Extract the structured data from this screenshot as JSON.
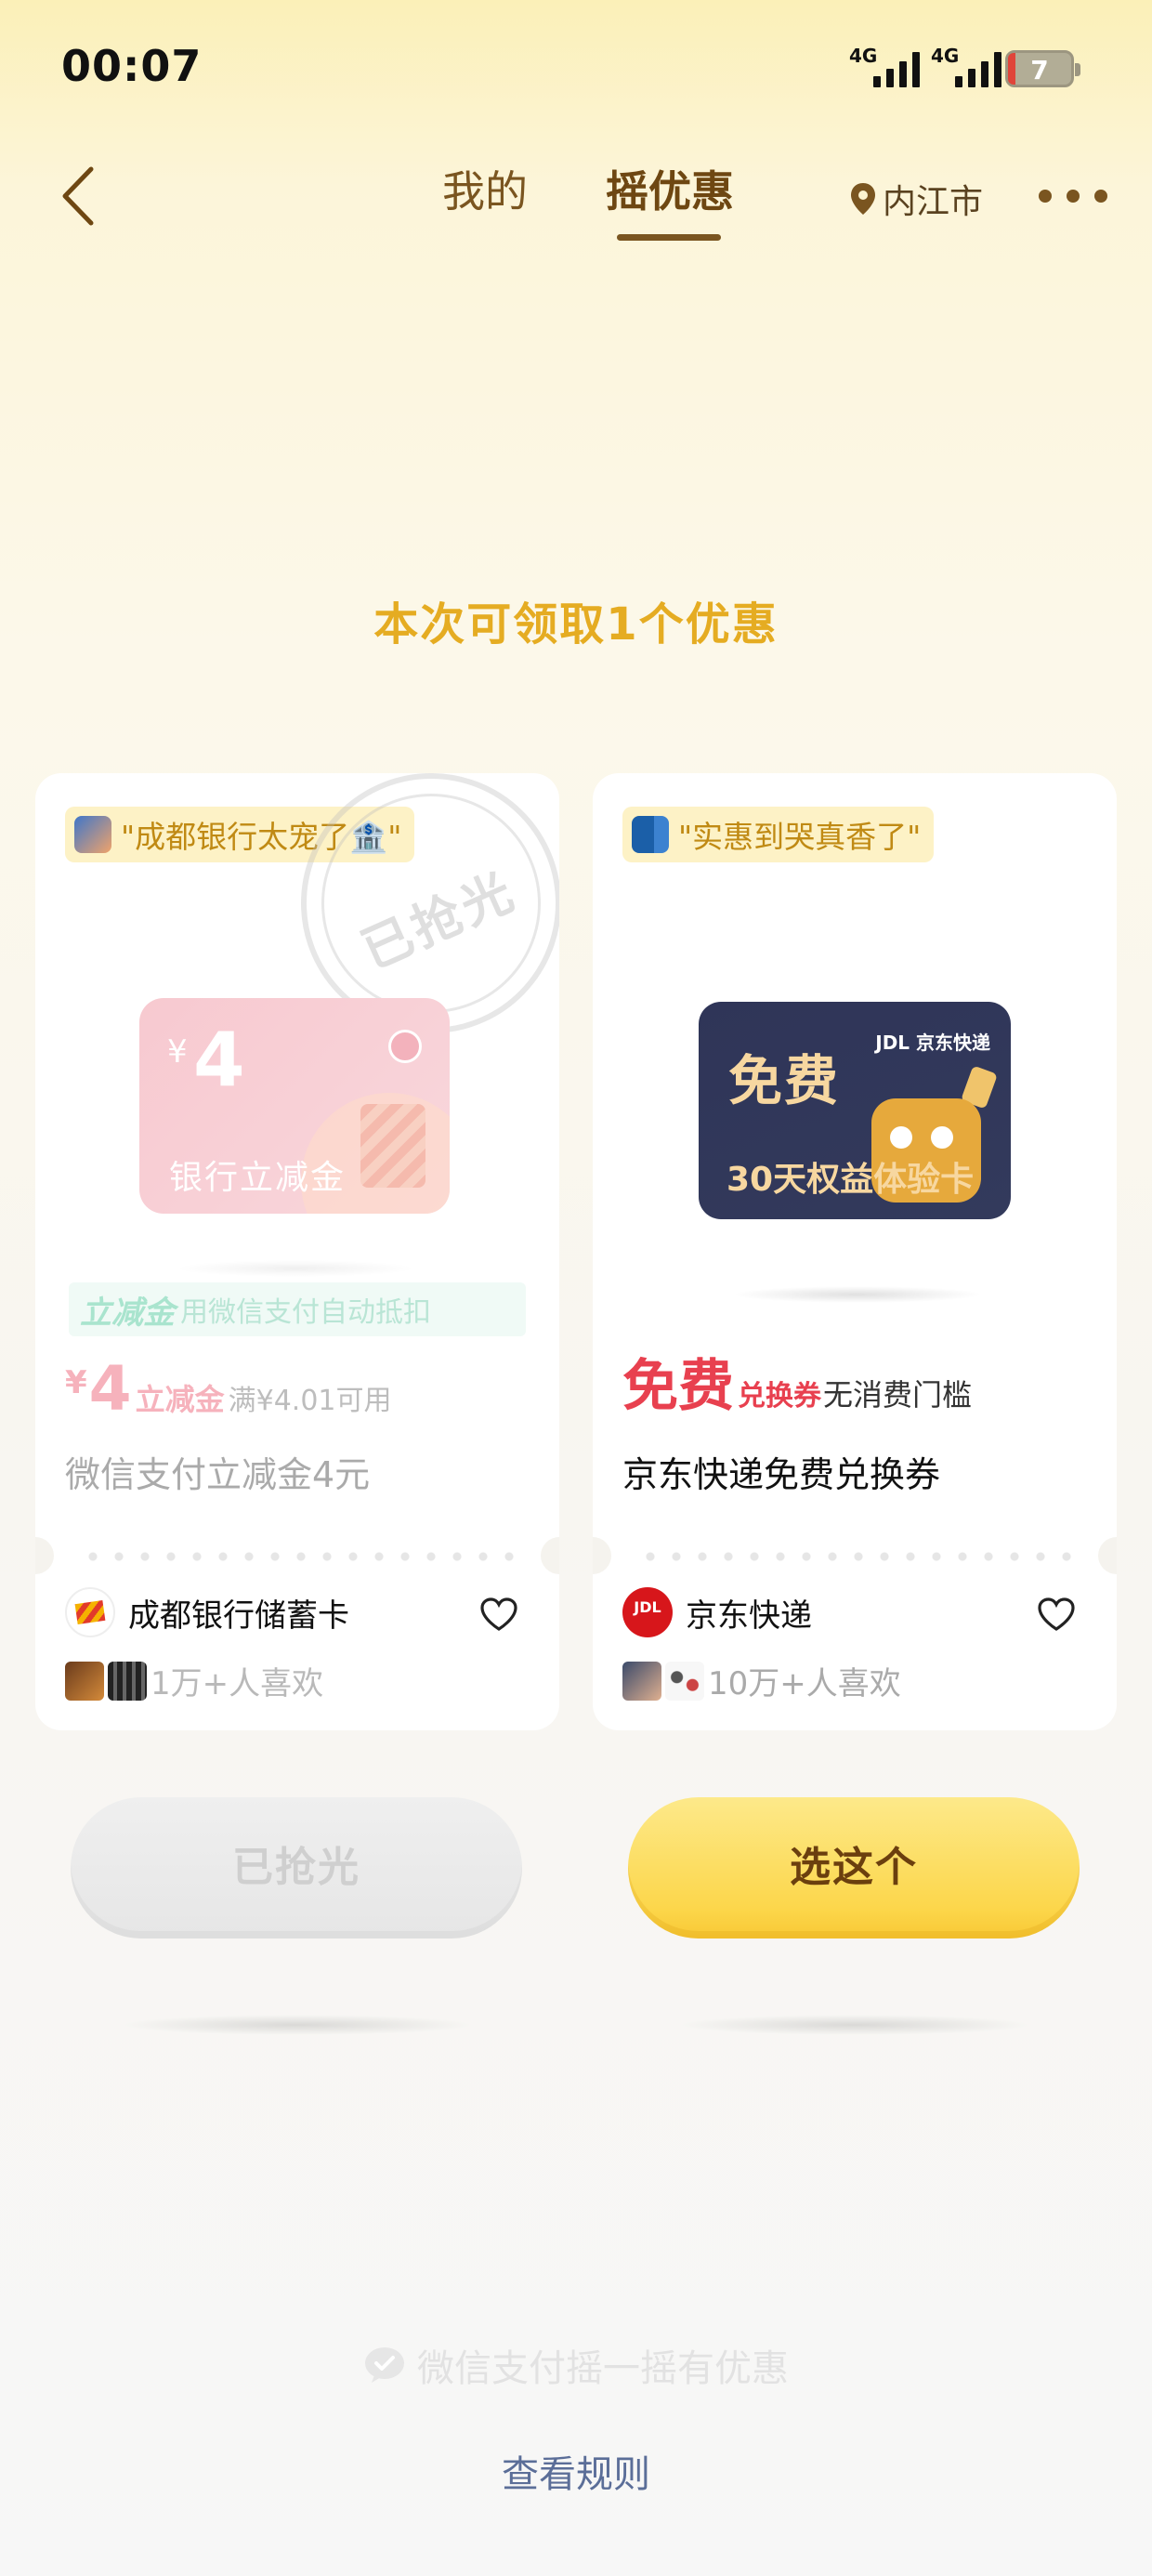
{
  "status_bar": {
    "time": "00:07",
    "signal1_tag": "4G",
    "signal2_tag": "4G",
    "battery": "7"
  },
  "nav": {
    "tabs": [
      {
        "label": "我的",
        "active": false
      },
      {
        "label": "摇优惠",
        "active": true
      }
    ],
    "location": "内江市",
    "icons": [
      "back-chevron-icon",
      "location-pin-icon",
      "more-dots-icon"
    ]
  },
  "headline": "本次可领取1个优惠",
  "cards": [
    {
      "tagline": "\"成都银行太宠了🏦\"",
      "stamp": "已抢光",
      "voucher": {
        "currency": "¥",
        "amount": "4",
        "label": "银行立减金"
      },
      "lijian_title": "立减金",
      "lijian_desc": "用微信支付自动抵扣",
      "price_currency": "¥",
      "price_amount": "4",
      "price_type": "立减金",
      "price_condition": "满¥4.01可用",
      "title": "微信支付立减金4元",
      "merchant": "成都银行储蓄卡",
      "likes": "1万+人喜欢",
      "button": "已抢光",
      "sold_out": true
    },
    {
      "tagline": "\"实惠到哭真香了\"",
      "voucher": {
        "headline": "免费",
        "subtitle": "30天权益体验卡",
        "brand": "JDL 京东快递"
      },
      "price_big": "免费",
      "price_type": "兑换券",
      "price_condition": "无消费门槛",
      "title": "京东快递免费兑换券",
      "merchant": "京东快递",
      "merchant_logo_text": "JDL",
      "likes": "10万+人喜欢",
      "button": "选这个",
      "sold_out": false
    }
  ],
  "footer": {
    "brand": "微信支付摇一摇有优惠",
    "rules": "查看规则"
  },
  "colors": {
    "accent_gold": "#e5ac22",
    "nav_brown": "#7a5520",
    "free_red": "#e8404f",
    "button_yellow": "#fcd64a",
    "rules_link": "#5b6e98"
  }
}
